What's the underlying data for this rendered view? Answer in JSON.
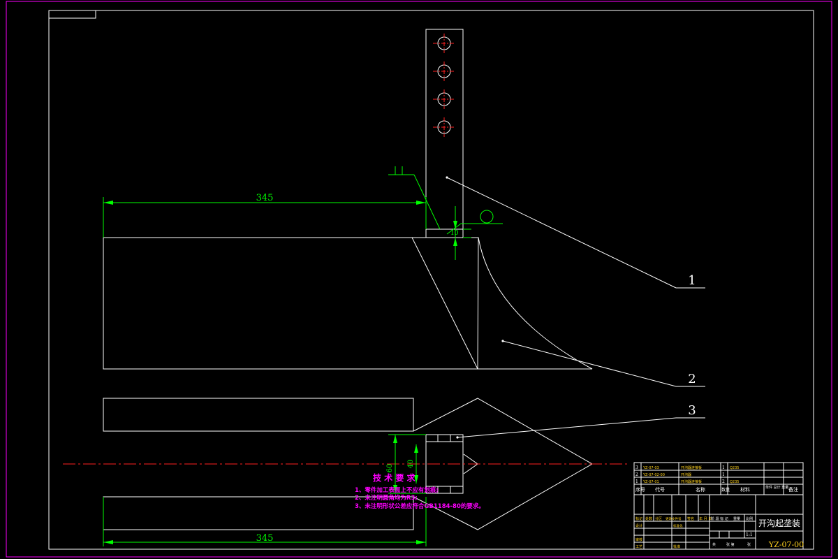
{
  "drawing": {
    "dimensions": {
      "length_top": "345",
      "length_bottom": "345",
      "gap": "10",
      "height_a": "60",
      "height_b": "40"
    },
    "balloons": [
      "1",
      "2",
      "3"
    ]
  },
  "tech_requirements": {
    "title": "技 术 要 求",
    "items": [
      "1、零件加工表面上不应有划痕;",
      "2、未注明圆角均为R3;",
      "3、未注明形状公差应符合GB1184-80的要求。"
    ]
  },
  "title_block": {
    "drawing_title": "开沟起垄装",
    "drawing_number": "YZ-07-00",
    "scale": "1:1",
    "header": {
      "seq": "序号",
      "code": "代号",
      "name": "名称",
      "qty": "数量",
      "material": "材料",
      "weight": "单件 总计 重量",
      "remark": "备注"
    },
    "parts": [
      {
        "seq": "3",
        "code": "YZ-07-03",
        "name": "开沟器连接板",
        "qty": "1",
        "material": "Q235"
      },
      {
        "seq": "2",
        "code": "YZ-07-02-00",
        "name": "开沟器",
        "qty": "1",
        "material": ""
      },
      {
        "seq": "1",
        "code": "YZ-07-01",
        "name": "开沟器连接板",
        "qty": "2",
        "material": "Q235"
      }
    ],
    "signoff": [
      "标记",
      "处数",
      "分区",
      "更改文件号",
      "签名",
      "年 月 日",
      "设计",
      "审核",
      "工艺",
      "标准化",
      "批准"
    ],
    "stage_row": [
      "阶 段 标 记",
      "重量",
      "比例"
    ],
    "sheet_row": [
      "共",
      "张 第",
      "张"
    ]
  }
}
